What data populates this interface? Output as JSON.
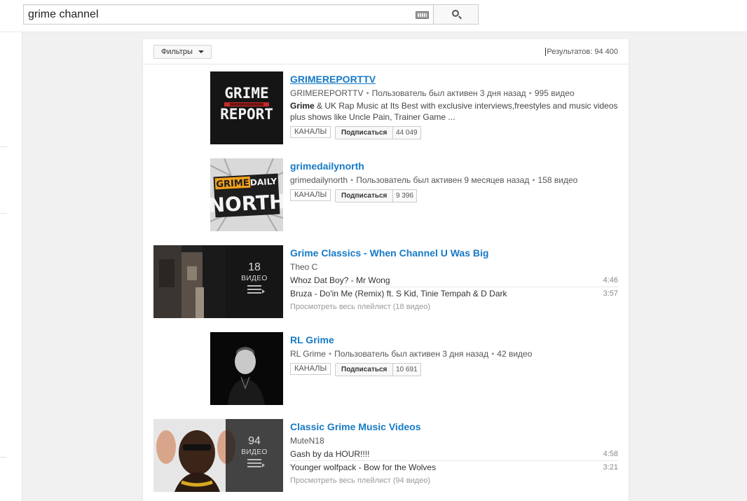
{
  "search": {
    "query": "grime channel"
  },
  "filters": {
    "label": "Фильтры"
  },
  "results": {
    "count_text": "Результатов: 94 400"
  },
  "colors": {
    "link": "#167ac6"
  },
  "items": [
    {
      "type": "channel",
      "title": "GRIMEREPORTTV",
      "owner": "GRIMEREPORTTV",
      "activity": "Пользователь был активен 3 дня назад",
      "videos": "995 видео",
      "desc_bold": "Grime",
      "desc_rest": " & UK Rap Music at Its Best with exclusive interviews,freestyles and music videos plus shows like Uncle Pain, Trainer Game ...",
      "badge": "КАНАЛЫ",
      "subscribe": "Подписаться",
      "subs": "44 049",
      "thumb_text_1": "GRIME",
      "thumb_text_2": "REPORT"
    },
    {
      "type": "channel",
      "title": "grimedailynorth",
      "owner": "grimedailynorth",
      "activity": "Пользователь был активен 9 месяцев назад",
      "videos": "158 видео",
      "badge": "КАНАЛЫ",
      "subscribe": "Подписаться",
      "subs": "9 396",
      "thumb_text_1": "GRIME",
      "thumb_text_2": "DAILY",
      "thumb_text_3": "NORTH"
    },
    {
      "type": "playlist",
      "title": "Grime Classics - When Channel U Was Big",
      "owner": "Theo C",
      "count": "18",
      "count_label": "ВИДЕО",
      "tracks": [
        {
          "title": "Whoz Dat Boy? - Mr Wong",
          "duration": "4:46"
        },
        {
          "title": "Bruza - Do'in Me (Remix) ft. S Kid, Tinie Tempah & D Dark",
          "duration": "3:57"
        }
      ],
      "view_all": "Просмотреть весь плейлист (18 видео)"
    },
    {
      "type": "channel",
      "title": "RL Grime",
      "owner": "RL Grime",
      "activity": "Пользователь был активен 3 дня назад",
      "videos": "42 видео",
      "badge": "КАНАЛЫ",
      "subscribe": "Подписаться",
      "subs": "10 691"
    },
    {
      "type": "playlist",
      "title": "Classic Grime Music Videos",
      "owner": "MuteN18",
      "count": "94",
      "count_label": "ВИДЕО",
      "tracks": [
        {
          "title": "Gash by da HOUR!!!!",
          "duration": "4:58"
        },
        {
          "title": "Younger wolfpack - Bow for the Wolves",
          "duration": "3:21"
        }
      ],
      "view_all": "Просмотреть весь плейлист (94 видео)"
    }
  ]
}
